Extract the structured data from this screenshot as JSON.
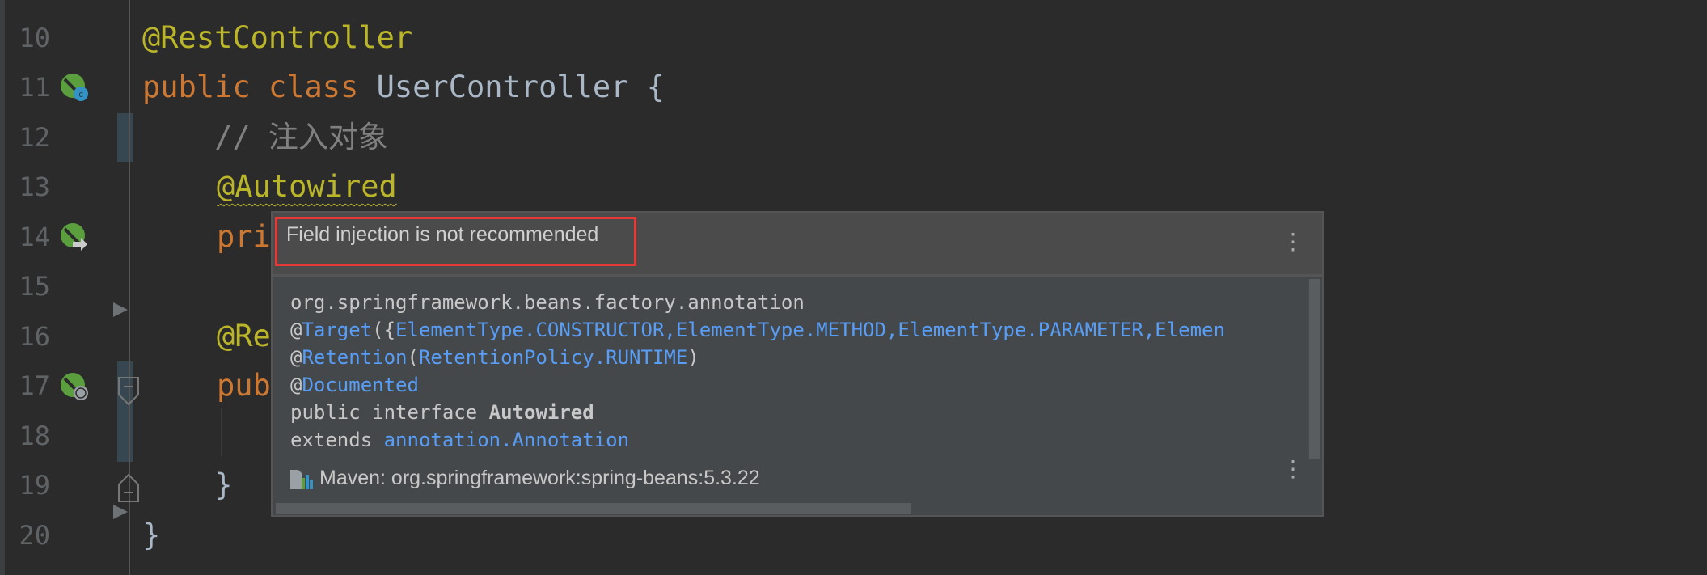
{
  "editor": {
    "line_numbers": [
      "10",
      "11",
      "12",
      "13",
      "14",
      "15",
      "16",
      "17",
      "18",
      "19",
      "20"
    ],
    "lines": {
      "l10": "@RestController",
      "l11_kw1": "public ",
      "l11_kw2": "class ",
      "l11_rest": "UserController {",
      "l12": "    // 注入对象",
      "l13": "@Autowired",
      "l14": "pri",
      "l16": "@Re",
      "l17": "pub",
      "l19": "    }",
      "l20": "}"
    },
    "gutter_icons": [
      "spring-bean-class-icon",
      "spring-autowired-icon",
      "spring-web-endpoint-icon"
    ]
  },
  "popup": {
    "title": "Field injection is not recommended",
    "doc": {
      "package": "org.springframework.beans.factory.annotation",
      "target_at": "@",
      "target": "Target",
      "target_open": "({",
      "target_args": "ElementType.CONSTRUCTOR,ElementType.METHOD,ElementType.PARAMETER,Elemen",
      "retention_at": "@",
      "retention": "Retention",
      "paren_open": "(",
      "retention_arg": "RetentionPolicy.RUNTIME",
      "paren_close": ")",
      "documented_at": "@",
      "documented": "Documented",
      "decl": "public interface ",
      "decl_name": "Autowired",
      "extends": "extends ",
      "extends_type": "annotation.Annotation"
    },
    "footer": "Maven: org.springframework:spring-beans:5.3.22"
  },
  "colors": {
    "annotation": "#bbb529",
    "keyword": "#cc7832",
    "link": "#589df6",
    "highlight_box": "#e53935"
  }
}
